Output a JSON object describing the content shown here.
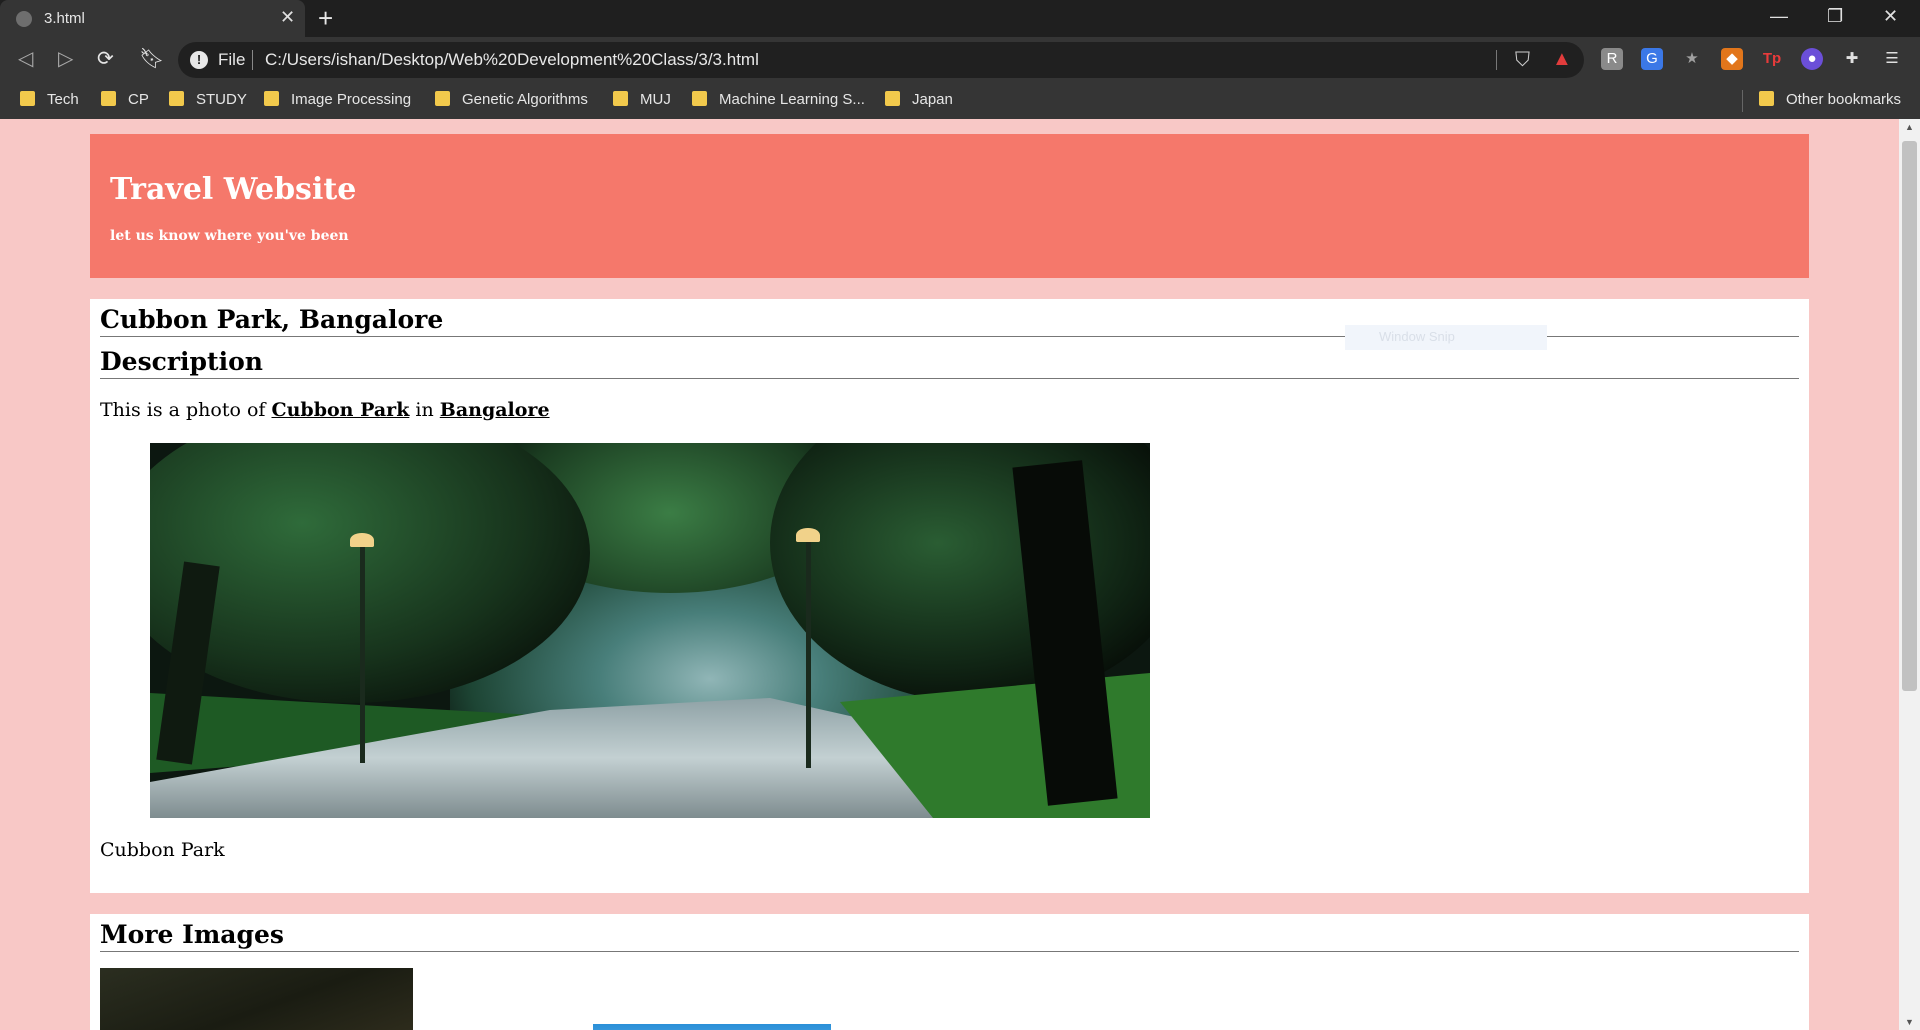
{
  "browser": {
    "tab_title": "3.html",
    "address_scheme": "File",
    "address_url": "C:/Users/ishan/Desktop/Web%20Development%20Class/3/3.html",
    "bookmarks": [
      "Tech",
      "CP",
      "STUDY",
      "Image Processing",
      "Genetic Algorithms",
      "MUJ",
      "Machine Learning S...",
      "Japan"
    ],
    "other_bookmarks": "Other bookmarks"
  },
  "page": {
    "banner_title": "Travel Website",
    "banner_tagline": "let us know where you've been",
    "place_heading": "Cubbon Park, Bangalore",
    "description_heading": "Description",
    "description_prefix": "This is a photo of ",
    "description_link1": "Cubbon Park",
    "description_mid": " in ",
    "description_link2": "Bangalore",
    "photo_caption": "Cubbon Park",
    "more_images_heading": "More Images",
    "overlay_text": "Window Snip"
  },
  "colors": {
    "page_bg": "#f8c8c6",
    "banner_bg": "#f5786b",
    "chrome_bg": "#353535"
  }
}
